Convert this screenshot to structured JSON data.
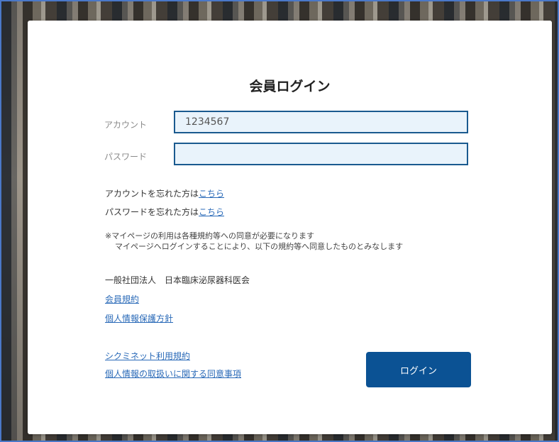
{
  "login": {
    "title": "会員ログイン",
    "account_label": "アカウント",
    "account_value": "1234567",
    "password_label": "パスワード",
    "password_value": ""
  },
  "forgot": {
    "account_prefix": "アカウントを忘れた方は",
    "account_link": "こちら",
    "password_prefix": "パスワードを忘れた方は",
    "password_link": "こちら"
  },
  "notice": {
    "line1": "※マイページの利用は各種規約等への同意が必要になります",
    "line2": "マイページへログインすることにより、以下の規約等へ同意したものとみなします"
  },
  "organization": {
    "name": "一般社団法人　日本臨床泌尿器科医会",
    "links": [
      "会員規約",
      "個人情報保護方針"
    ]
  },
  "footer_links": [
    "シクミネット利用規約",
    "個人情報の取扱いに関する同意事項"
  ],
  "login_button": "ログイン",
  "colors": {
    "primary": "#0b5294",
    "input_bg": "#e9f3fb",
    "input_border": "#1a5a8f",
    "link": "#2a6ab8"
  }
}
